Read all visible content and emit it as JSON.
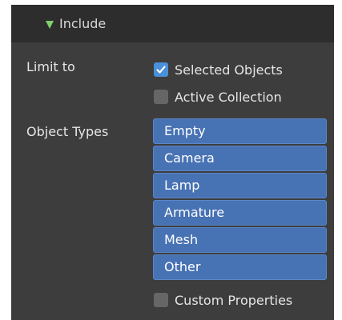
{
  "panel": {
    "header": {
      "title": "Include",
      "expanded": true,
      "arrow_color": "#7fcf6c"
    },
    "limit_to": {
      "label": "Limit to",
      "options": [
        {
          "label": "Selected Objects",
          "checked": true
        },
        {
          "label": "Active Collection",
          "checked": false
        }
      ]
    },
    "object_types": {
      "label": "Object Types",
      "items": [
        "Empty",
        "Camera",
        "Lamp",
        "Armature",
        "Mesh",
        "Other"
      ],
      "selected_color": "#4772b3"
    },
    "custom_properties": {
      "label": "Custom Properties",
      "checked": false
    }
  }
}
